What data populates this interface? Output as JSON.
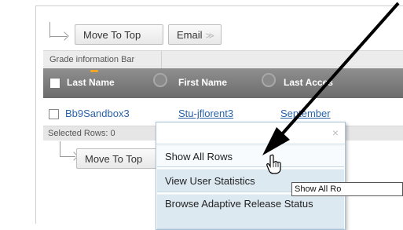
{
  "toolbar": {
    "move_to_top_label": "Move To Top",
    "email_label": "Email",
    "email_chevron": "≫"
  },
  "grade_bar": {
    "label": "Grade information Bar"
  },
  "table": {
    "columns": [
      "Last Name",
      "First Name",
      "Last Acces"
    ],
    "rows": [
      {
        "last_name": "Bb9Sandbox3",
        "first_name": "Stu-jflorent3",
        "last_access": "September"
      }
    ]
  },
  "selection": {
    "label": "Selected Rows: 0"
  },
  "bottom_toolbar": {
    "move_to_top_label": "Move To Top"
  },
  "context_menu": {
    "close_glyph": "×",
    "items": [
      {
        "label": "Show All Rows"
      },
      {
        "label": "View User Statistics"
      },
      {
        "label": "Browse Adaptive Release Status"
      }
    ]
  },
  "tooltip": {
    "text": "Show All Ro"
  },
  "colors": {
    "link": "#2a63a8",
    "menu_bg": "#dde9f1",
    "header_bg": "#7a7a7a",
    "sort_accent": "#f5a623"
  },
  "icons": [
    "arrow-corner-icon",
    "chevron-down-icon",
    "sort-circle-icon",
    "close-icon",
    "hand-cursor-icon",
    "annotation-arrow-icon"
  ]
}
